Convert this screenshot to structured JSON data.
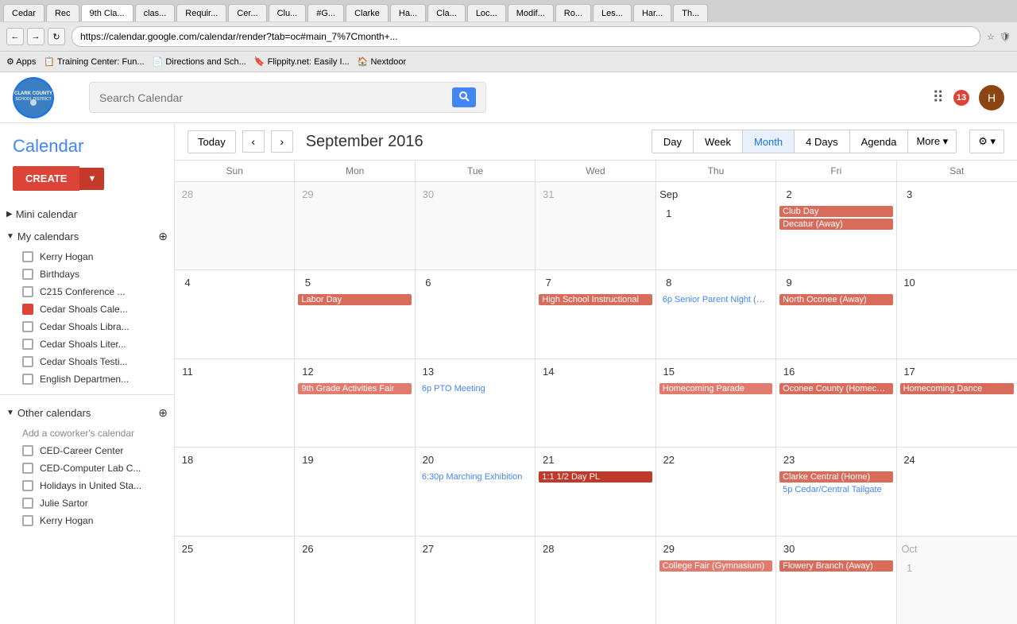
{
  "browser": {
    "tabs": [
      {
        "label": "Cedar",
        "active": false
      },
      {
        "label": "Rec",
        "active": false
      },
      {
        "label": "9th Cla...",
        "active": false
      },
      {
        "label": "clas...",
        "active": false
      },
      {
        "label": "Requir...",
        "active": false
      },
      {
        "label": "Cer...",
        "active": false
      },
      {
        "label": "Clu...",
        "active": false
      },
      {
        "label": "#G...",
        "active": false
      },
      {
        "label": "Clarke",
        "active": false
      },
      {
        "label": "Ha...",
        "active": false
      },
      {
        "label": "Cla...",
        "active": false
      },
      {
        "label": "Loc...",
        "active": false
      },
      {
        "label": "Modif...",
        "active": false
      },
      {
        "label": "Ro...",
        "active": false
      },
      {
        "label": "Les...",
        "active": false
      },
      {
        "label": "Har...",
        "active": false
      },
      {
        "label": "Th...",
        "active": false
      }
    ],
    "url": "https://calendar.google.com/calendar/render?tab=oc#main_7%7Cmonth+...",
    "bookmarks": [
      "Apps",
      "Training Center: Fun...",
      "Directions and Sch...",
      "Flippity.net: Easily I...",
      "Nextdoor"
    ]
  },
  "header": {
    "search_placeholder": "Search Calendar",
    "notification_count": "13",
    "user_initial": "H"
  },
  "sidebar": {
    "title": "Calendar",
    "create_label": "CREATE",
    "mini_calendar_label": "Mini calendar",
    "my_calendars_label": "My calendars",
    "other_calendars_label": "Other calendars",
    "add_coworker_label": "Add a coworker's calendar",
    "my_calendar_items": [
      {
        "label": "Kerry Hogan",
        "checked": false
      },
      {
        "label": "Birthdays",
        "checked": false
      },
      {
        "label": "C215 Conference ...",
        "checked": false
      },
      {
        "label": "Cedar Shoals Cale...",
        "checked": true
      },
      {
        "label": "Cedar Shoals Libra...",
        "checked": false
      },
      {
        "label": "Cedar Shoals Liter...",
        "checked": false
      },
      {
        "label": "Cedar Shoals Testi...",
        "checked": false
      },
      {
        "label": "English Departmen...",
        "checked": false
      }
    ],
    "other_calendar_items": [
      {
        "label": "CED-Career Center",
        "checked": false
      },
      {
        "label": "CED-Computer Lab C...",
        "checked": false
      },
      {
        "label": "Holidays in United Sta...",
        "checked": false
      },
      {
        "label": "Julie Sartor",
        "checked": false
      },
      {
        "label": "Kerry Hogan",
        "checked": false
      }
    ]
  },
  "calendar": {
    "month_year": "September 2016",
    "today_label": "Today",
    "view_buttons": [
      "Day",
      "Week",
      "Month",
      "4 Days",
      "Agenda"
    ],
    "more_label": "More",
    "active_view": "Month",
    "day_headers": [
      "Sun",
      "Mon",
      "Tue",
      "Wed",
      "Thu",
      "Fri",
      "Sat"
    ],
    "weeks": [
      {
        "days": [
          {
            "num": "28",
            "other": true,
            "events": []
          },
          {
            "num": "29",
            "other": true,
            "events": []
          },
          {
            "num": "30",
            "other": true,
            "events": []
          },
          {
            "num": "31",
            "other": true,
            "events": []
          },
          {
            "num": "Sep 1",
            "other": false,
            "events": []
          },
          {
            "num": "2",
            "other": false,
            "events": [
              {
                "label": "Club Day",
                "type": "red"
              },
              {
                "label": "Decatur (Away)",
                "type": "red"
              }
            ]
          },
          {
            "num": "3",
            "other": false,
            "events": []
          }
        ]
      },
      {
        "days": [
          {
            "num": "4",
            "other": false,
            "events": []
          },
          {
            "num": "5",
            "other": false,
            "events": [
              {
                "label": "Labor Day",
                "type": "red"
              }
            ]
          },
          {
            "num": "6",
            "other": false,
            "events": []
          },
          {
            "num": "7",
            "other": false,
            "events": [
              {
                "label": "High School Instructional",
                "type": "red"
              }
            ]
          },
          {
            "num": "8",
            "other": false,
            "events": [
              {
                "label": "6p Senior Parent Night (The...",
                "type": "blue-text"
              }
            ]
          },
          {
            "num": "9",
            "other": false,
            "events": [
              {
                "label": "North Oconee (Away)",
                "type": "red"
              }
            ]
          },
          {
            "num": "10",
            "other": false,
            "events": []
          }
        ]
      },
      {
        "days": [
          {
            "num": "11",
            "other": false,
            "events": []
          },
          {
            "num": "12",
            "other": false,
            "events": [
              {
                "label": "9th Grade Activities Fair",
                "type": "salmon"
              }
            ]
          },
          {
            "num": "13",
            "other": false,
            "events": [
              {
                "label": "6p PTO Meeting",
                "type": "blue-text"
              }
            ]
          },
          {
            "num": "14",
            "other": false,
            "events": []
          },
          {
            "num": "15",
            "other": false,
            "events": [
              {
                "label": "Homecoming Parade",
                "type": "salmon"
              }
            ]
          },
          {
            "num": "16",
            "other": false,
            "events": [
              {
                "label": "Oconee County (Homecon...",
                "type": "red"
              }
            ]
          },
          {
            "num": "17",
            "other": false,
            "events": [
              {
                "label": "Homecoming Dance",
                "type": "red"
              }
            ]
          }
        ]
      },
      {
        "days": [
          {
            "num": "18",
            "other": false,
            "events": []
          },
          {
            "num": "19",
            "other": false,
            "events": []
          },
          {
            "num": "20",
            "other": false,
            "events": [
              {
                "label": "6:30p Marching Exhibition",
                "type": "blue-text"
              }
            ]
          },
          {
            "num": "21",
            "other": false,
            "events": [
              {
                "label": "1:1 1/2 Day PL",
                "type": "dark-red"
              }
            ]
          },
          {
            "num": "22",
            "other": false,
            "events": []
          },
          {
            "num": "23",
            "other": false,
            "events": [
              {
                "label": "Clarke Central (Home)",
                "type": "red"
              },
              {
                "label": "5p Cedar/Central Tailgate",
                "type": "blue-text"
              }
            ]
          },
          {
            "num": "24",
            "other": false,
            "events": []
          }
        ]
      },
      {
        "days": [
          {
            "num": "25",
            "other": false,
            "events": []
          },
          {
            "num": "26",
            "other": false,
            "events": []
          },
          {
            "num": "27",
            "other": false,
            "events": []
          },
          {
            "num": "28",
            "other": false,
            "events": []
          },
          {
            "num": "29",
            "other": false,
            "events": [
              {
                "label": "College Fair (Gymnasium)",
                "type": "salmon"
              }
            ]
          },
          {
            "num": "30",
            "other": false,
            "events": [
              {
                "label": "Flowery Branch (Away)",
                "type": "red"
              }
            ]
          },
          {
            "num": "Oct 1",
            "other": true,
            "events": []
          }
        ]
      }
    ]
  }
}
